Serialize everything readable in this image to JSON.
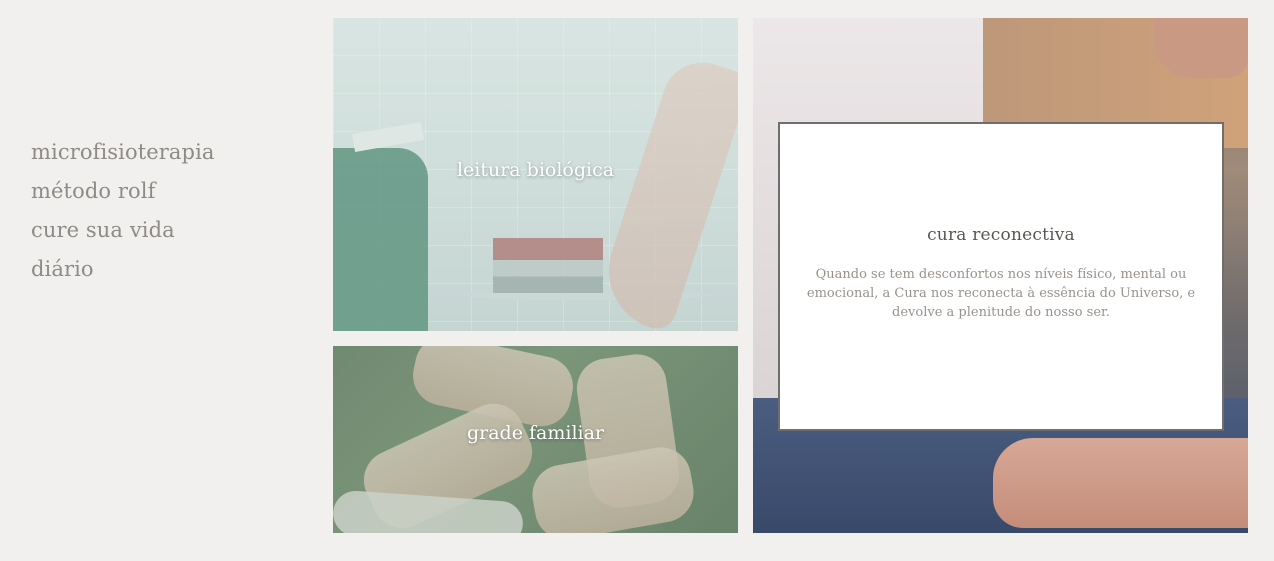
{
  "nav": {
    "items": [
      {
        "label": "microfisioterapia"
      },
      {
        "label": "método rolf"
      },
      {
        "label": "cure sua vida"
      },
      {
        "label": "diário"
      }
    ]
  },
  "tiles": {
    "leitura": {
      "label": "leitura biológica"
    },
    "grade": {
      "label": "grade familiar"
    },
    "cura": {
      "title": "cura reconectiva",
      "description": "Quando se tem desconfortos nos níveis físico, mental ou emocional, a Cura nos reconecta à essência do Universo, e devolve a plenitude do nosso ser."
    }
  },
  "colors": {
    "page_bg": "#f1f0ee",
    "nav_text": "#8e8b86",
    "card_border": "#6f6e6c",
    "card_title": "#5a5753",
    "card_text": "#98928b"
  }
}
